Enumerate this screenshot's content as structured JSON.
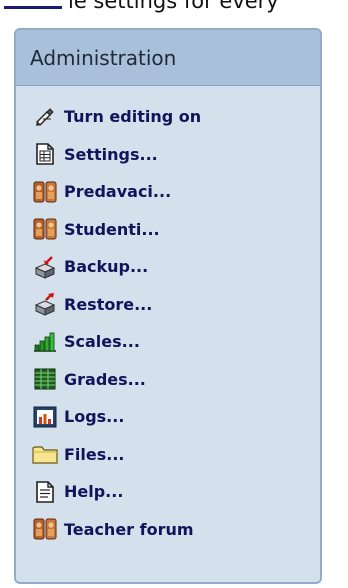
{
  "top_fragment": {
    "text": "le settings for every"
  },
  "block": {
    "title": "Administration",
    "items": [
      {
        "label": "Turn editing on",
        "icon": "edit-pencil-icon"
      },
      {
        "label": "Settings...",
        "icon": "settings-document-icon"
      },
      {
        "label": "Predavaci...",
        "icon": "teachers-people-icon"
      },
      {
        "label": "Studenti...",
        "icon": "students-people-icon"
      },
      {
        "label": "Backup...",
        "icon": "backup-box-icon"
      },
      {
        "label": "Restore...",
        "icon": "restore-box-icon"
      },
      {
        "label": "Scales...",
        "icon": "scales-bar-chart-icon"
      },
      {
        "label": "Grades...",
        "icon": "grades-spreadsheet-icon"
      },
      {
        "label": "Logs...",
        "icon": "logs-chart-icon"
      },
      {
        "label": "Files...",
        "icon": "folder-icon"
      },
      {
        "label": "Help...",
        "icon": "help-document-icon"
      },
      {
        "label": "Teacher forum",
        "icon": "teacher-forum-people-icon"
      }
    ]
  },
  "colors": {
    "panel_background": "#d4e0ec",
    "header_background": "#a9c0db",
    "link_text": "#13135a"
  }
}
